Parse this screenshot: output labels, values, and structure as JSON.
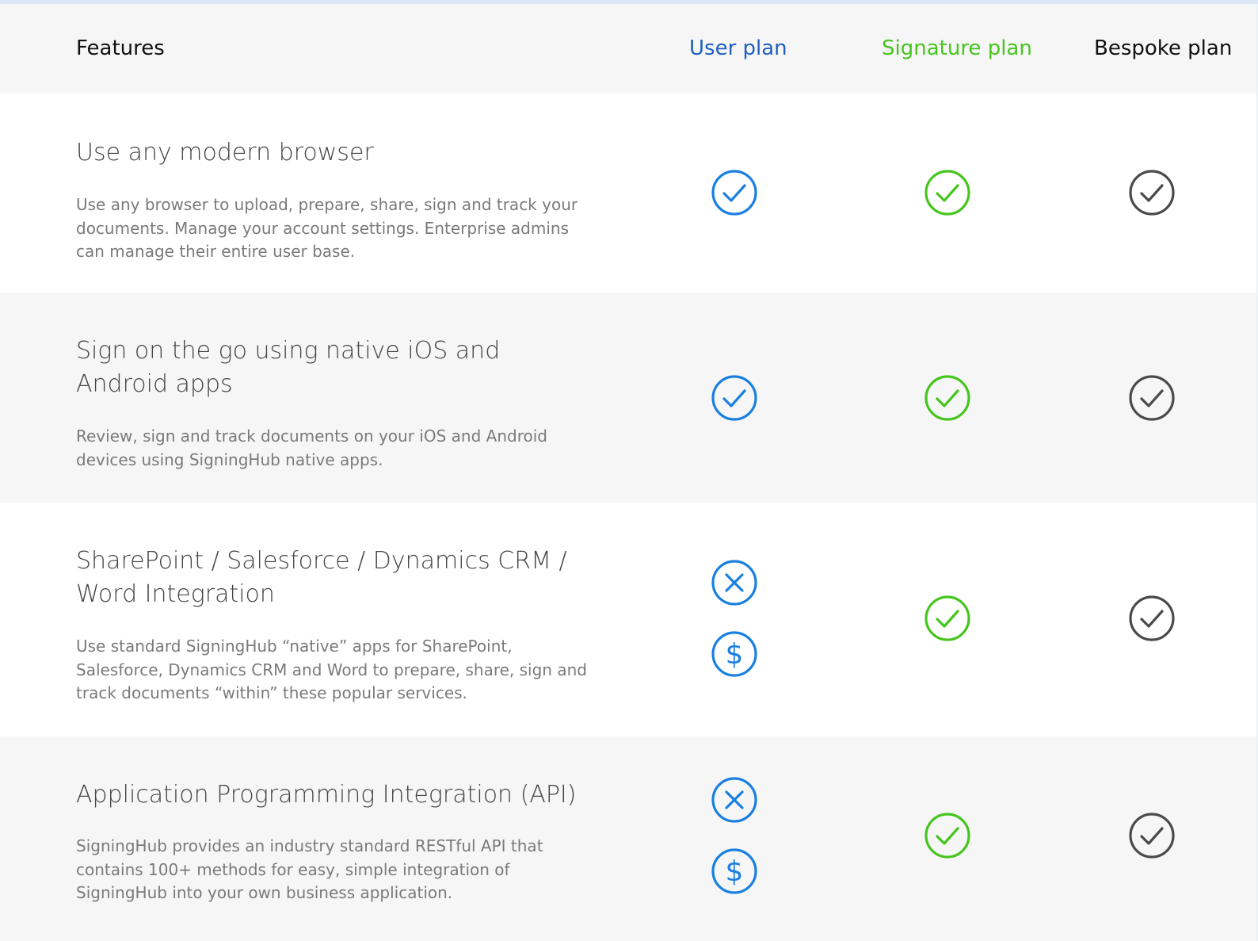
{
  "header": {
    "features_label": "Features",
    "plans": [
      {
        "label": "User plan",
        "color": "#1f5fbf"
      },
      {
        "label": "Signature plan",
        "color": "#46c51e"
      },
      {
        "label": "Bespoke plan",
        "color": "#111111"
      }
    ]
  },
  "icon_colors": {
    "user": "#1a7fe0",
    "signature": "#46c51e",
    "bespoke": "#4a4a4a"
  },
  "features": [
    {
      "title": "Use any modern browser",
      "description": "Use any browser to upload, prepare, share, sign and track your documents. Manage your account settings. Enterprise admins can manage their entire user base.",
      "user": [
        "check-icon"
      ],
      "signature": [
        "check-icon"
      ],
      "bespoke": [
        "check-icon"
      ]
    },
    {
      "title": "Sign on the go using native iOS and Android apps",
      "description": "Review, sign and track documents on your iOS and Android devices using SigningHub native apps.",
      "user": [
        "check-icon"
      ],
      "signature": [
        "check-icon"
      ],
      "bespoke": [
        "check-icon"
      ]
    },
    {
      "title": "SharePoint / Salesforce / Dynamics CRM / Word Integration",
      "description": "Use standard SigningHub “native” apps for SharePoint, Salesforce, Dynamics CRM and Word to prepare, share, sign and track documents “within” these popular services.",
      "user": [
        "cross-icon",
        "dollar-icon"
      ],
      "signature": [
        "check-icon"
      ],
      "bespoke": [
        "check-icon"
      ]
    },
    {
      "title": "Application Programming Integration (API)",
      "description": "SigningHub provides an industry standard RESTful API that contains 100+ methods for easy, simple integration of SigningHub into your own business application.",
      "user": [
        "cross-icon",
        "dollar-icon"
      ],
      "signature": [
        "check-icon"
      ],
      "bespoke": [
        "check-icon"
      ]
    }
  ]
}
